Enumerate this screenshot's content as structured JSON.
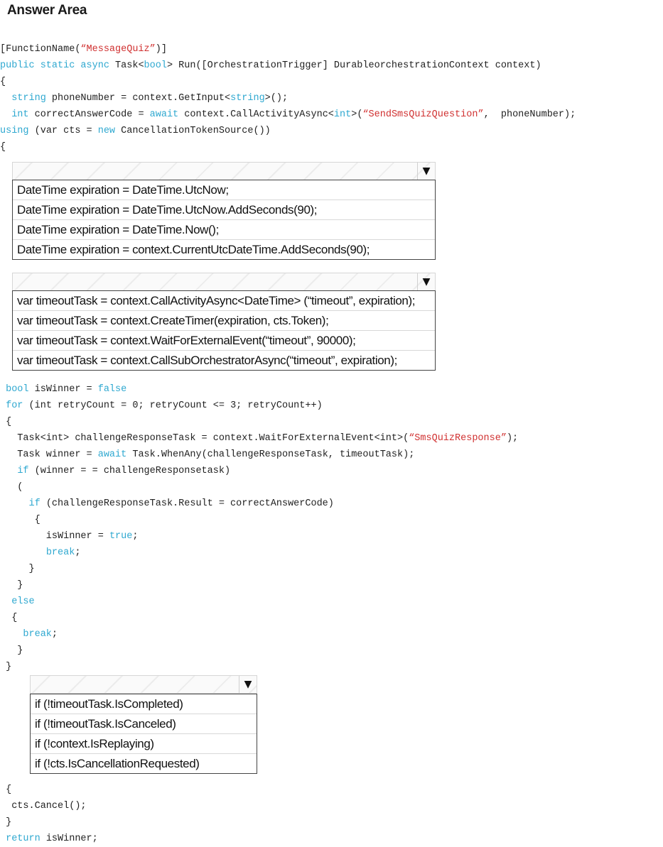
{
  "title": "Answer Area",
  "code_top": [
    [
      {
        "t": "[FunctionName("
      },
      {
        "t": "“MessageQuiz”",
        "c": "str"
      },
      {
        "t": ")]"
      }
    ],
    [
      {
        "t": "public static async",
        "c": "kw"
      },
      {
        "t": " Task<"
      },
      {
        "t": "bool",
        "c": "kw"
      },
      {
        "t": "> Run([OrchestrationTrigger] DurableorchestrationContext context)"
      }
    ],
    [
      {
        "t": "{"
      }
    ],
    [
      {
        "t": "  "
      },
      {
        "t": "string",
        "c": "kw"
      },
      {
        "t": " phoneNumber = context.GetInput<"
      },
      {
        "t": "string",
        "c": "kw"
      },
      {
        "t": ">();"
      }
    ],
    [
      {
        "t": "  "
      },
      {
        "t": "int",
        "c": "kw"
      },
      {
        "t": " correctAnswerCode = "
      },
      {
        "t": "await",
        "c": "kw"
      },
      {
        "t": " context.CallActivityAsync<"
      },
      {
        "t": "int",
        "c": "kw"
      },
      {
        "t": ">("
      },
      {
        "t": "“SendSmsQuizQuestion”",
        "c": "str"
      },
      {
        "t": ",  phoneNumber);"
      }
    ],
    [
      {
        "t": "using",
        "c": "kw"
      },
      {
        "t": " (var cts = "
      },
      {
        "t": "new",
        "c": "kw"
      },
      {
        "t": " CancellationTokenSource())"
      }
    ],
    [
      {
        "t": "{"
      }
    ]
  ],
  "dropdown1": {
    "options": [
      "DateTime expiration = DateTime.UtcNow;",
      "DateTime expiration = DateTime.UtcNow.AddSeconds(90);",
      "DateTime expiration = DateTime.Now();",
      "DateTime expiration = context.CurrentUtcDateTime.AddSeconds(90);"
    ]
  },
  "dropdown2": {
    "options": [
      "var timeoutTask = context.CallActivityAsync<DateTime> (“timeout”, expiration);",
      "var timeoutTask = context.CreateTimer(expiration, cts.Token);",
      "var timeoutTask = context.WaitForExternalEvent(“timeout”, 90000);",
      "var timeoutTask = context.CallSubOrchestratorAsync(“timeout”, expiration);"
    ]
  },
  "code_mid": [
    [
      {
        "t": " "
      },
      {
        "t": "bool",
        "c": "kw"
      },
      {
        "t": " isWinner = "
      },
      {
        "t": "false",
        "c": "kw"
      }
    ],
    [
      {
        "t": " "
      },
      {
        "t": "for",
        "c": "kw"
      },
      {
        "t": " (int retryCount = 0; retryCount <= 3; retryCount++)"
      }
    ],
    [
      {
        "t": " {"
      }
    ],
    [
      {
        "t": "   Task<int> challengeResponseTask = context.WaitForExternalEvent<int>("
      },
      {
        "t": "“SmsQuizResponse”",
        "c": "str"
      },
      {
        "t": ");"
      }
    ],
    [
      {
        "t": "   Task winner = "
      },
      {
        "t": "await",
        "c": "kw"
      },
      {
        "t": " Task.WhenAny(challengeResponseTask, timeoutTask);"
      }
    ],
    [
      {
        "t": "   "
      },
      {
        "t": "if",
        "c": "kw"
      },
      {
        "t": " (winner = = challengeResponsetask)"
      }
    ],
    [
      {
        "t": "   ("
      }
    ],
    [
      {
        "t": "     "
      },
      {
        "t": "if",
        "c": "kw"
      },
      {
        "t": " (challengeResponseTask.Result = correctAnswerCode)"
      }
    ],
    [
      {
        "t": "      {"
      }
    ],
    [
      {
        "t": "        isWinner = "
      },
      {
        "t": "true",
        "c": "kw"
      },
      {
        "t": ";"
      }
    ],
    [
      {
        "t": "        "
      },
      {
        "t": "break",
        "c": "kw"
      },
      {
        "t": ";"
      }
    ],
    [
      {
        "t": "     }"
      }
    ],
    [
      {
        "t": "   }"
      }
    ],
    [
      {
        "t": "  "
      },
      {
        "t": "else",
        "c": "kw"
      }
    ],
    [
      {
        "t": "  {"
      }
    ],
    [
      {
        "t": "    "
      },
      {
        "t": "break",
        "c": "kw"
      },
      {
        "t": ";"
      }
    ],
    [
      {
        "t": "   }"
      }
    ],
    [
      {
        "t": " }"
      }
    ]
  ],
  "dropdown3": {
    "options": [
      "if (!timeoutTask.IsCompleted)",
      "if (!timeoutTask.IsCanceled)",
      "if (!context.IsReplaying)",
      "if (!cts.IsCancellationRequested)"
    ]
  },
  "code_bottom": [
    [
      {
        "t": " {"
      }
    ],
    [
      {
        "t": "  cts.Cancel();"
      }
    ],
    [
      {
        "t": " }"
      }
    ],
    [
      {
        "t": " "
      },
      {
        "t": "return",
        "c": "kw"
      },
      {
        "t": " isWinner;"
      }
    ]
  ],
  "icons": {
    "dropdown_arrow": "▼"
  }
}
